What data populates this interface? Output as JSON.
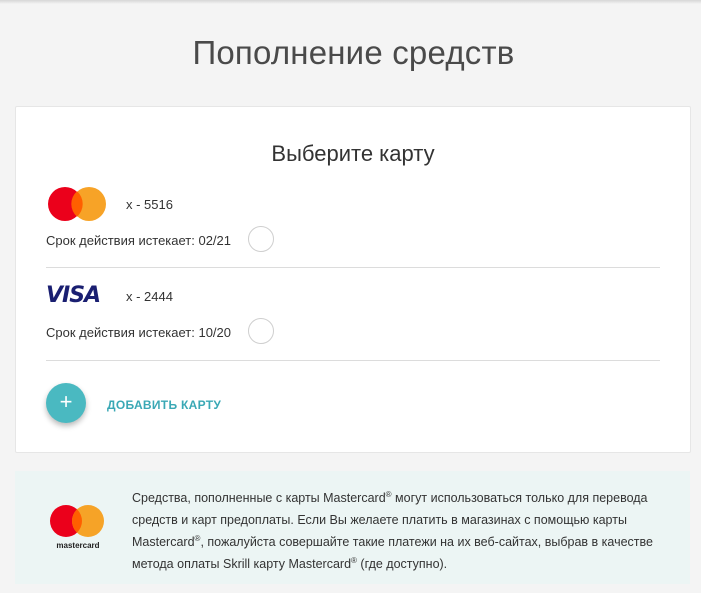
{
  "page": {
    "title": "Пополнение средств"
  },
  "panel": {
    "title": "Выберите карту",
    "cards": [
      {
        "brand": "mastercard",
        "number": "x - 5516",
        "expiry": "Срок действия истекает: 02/21"
      },
      {
        "brand": "visa",
        "brand_text": "VISA",
        "number": "x - 2444",
        "expiry": "Срок действия истекает: 10/20"
      }
    ],
    "add_button": {
      "icon": "+",
      "label": "ДОБАВИТЬ КАРТУ"
    }
  },
  "info": {
    "logo_text": "mastercard",
    "text_part1": "Средства, пополненные с карты Mastercard",
    "text_part2": " могут использоваться только для перевода средств и карт предоплаты. Если Вы желаете платить в магазинах с помощью карты Mastercard",
    "text_part3": ", пожалуйста совершайте такие платежи на их веб-сайтах, выбрав в качестве метода оплаты Skrill карту Mastercard",
    "text_part4": " (где доступно).",
    "reg_mark": "®"
  },
  "colors": {
    "accent": "#4ab9c1",
    "accent_text": "#3aa8b5",
    "mc_red": "#eb001b",
    "mc_orange": "#f79e1b",
    "visa_blue": "#1a1f71",
    "info_bg": "#ecf5f4"
  }
}
